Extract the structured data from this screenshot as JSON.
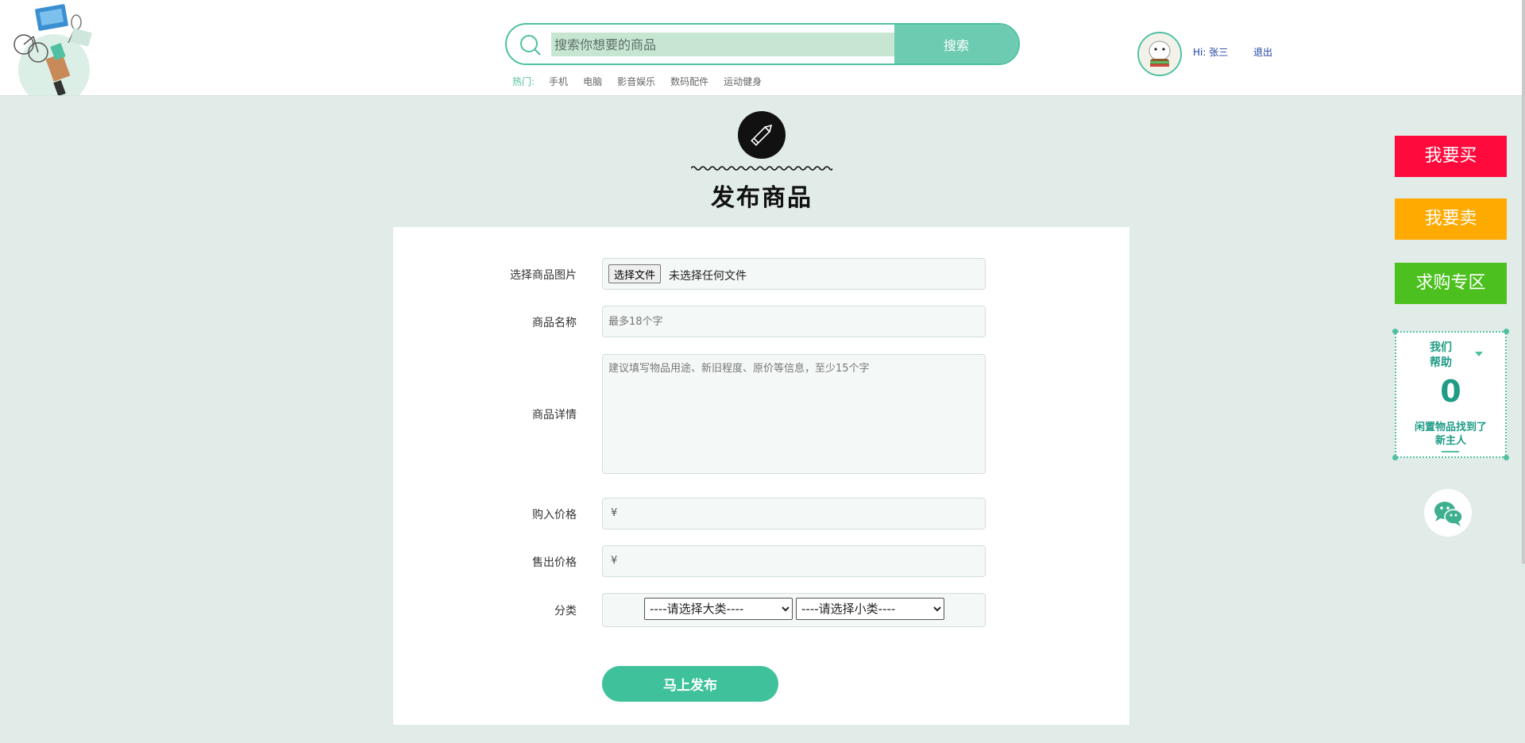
{
  "header": {
    "search": {
      "placeholder": "搜索你想要的商品",
      "button_label": "搜索"
    },
    "hot_label": "热门:",
    "hot_items": [
      "手机",
      "电脑",
      "影音娱乐",
      "数码配件",
      "运动健身"
    ],
    "user": {
      "greeting": "Hi: 张三",
      "logout_label": "退出"
    }
  },
  "page": {
    "title": "发布商品",
    "title_icon": "pencil-icon"
  },
  "form": {
    "image": {
      "label": "选择商品图片",
      "button_label": "选择文件",
      "status": "未选择任何文件"
    },
    "name": {
      "label": "商品名称",
      "placeholder": "最多18个字"
    },
    "detail": {
      "label": "商品详情",
      "placeholder": "建议填写物品用途、新旧程度、原价等信息，至少15个字"
    },
    "buy_price": {
      "label": "购入价格",
      "currency": "¥"
    },
    "sell_price": {
      "label": "售出价格",
      "currency": "¥"
    },
    "category": {
      "label": "分类",
      "major_selected": "----请选择大类----",
      "minor_selected": "----请选择小类----"
    },
    "submit_label": "马上发布"
  },
  "sidebar": {
    "buy_label": "我要买",
    "sell_label": "我要卖",
    "request_label": "求购专区",
    "help": {
      "title_line1": "我们",
      "title_line2": "帮助",
      "count": "0",
      "caption_line1": "闲置物品找到了",
      "caption_line2": "新主人"
    },
    "wechat_icon": "wechat-icon"
  },
  "colors": {
    "accent": "#3fc29b",
    "page_background": "#e1ebe8",
    "buy_button": "#ff0a3c",
    "sell_button": "#ffaa00",
    "request_button": "#4cc01e"
  }
}
